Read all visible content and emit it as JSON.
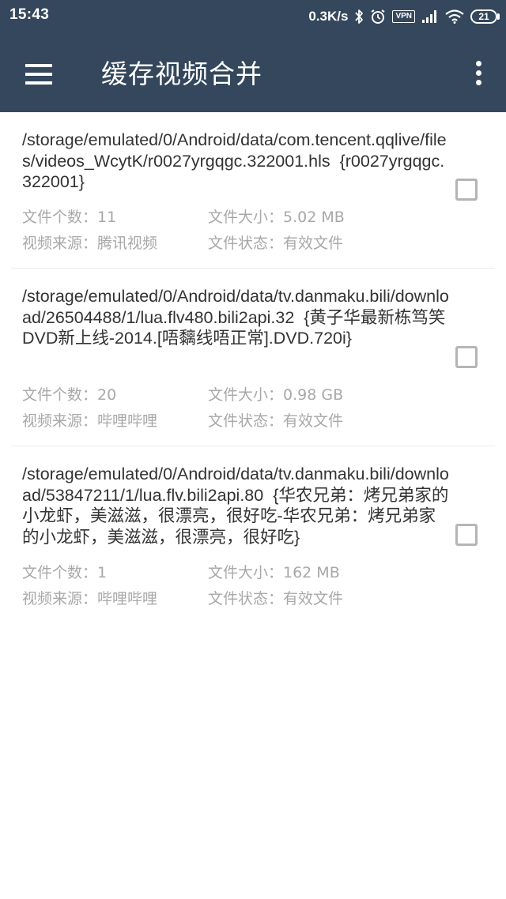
{
  "status_bar": {
    "time": "15:43",
    "network_speed": "0.3K/s",
    "bluetooth_icon": "bluetooth-icon",
    "alarm_icon": "alarm-icon",
    "vpn_label": "VPN",
    "signal_icon": "signal-icon",
    "wifi_icon": "wifi-icon",
    "battery_level": "21"
  },
  "toolbar": {
    "menu_icon": "hamburger-menu-icon",
    "title": "缓存视频合并",
    "overflow_icon": "more-vert-icon",
    "background_color": "#34475c"
  },
  "items": [
    {
      "path": "/storage/emulated/0/Android/data/com.tencent.qqlive/files/videos_WcytK/r0027yrgqgc.322001.hls",
      "name": "{r0027yrgqgc.322001}",
      "file_count_label": "文件个数：11",
      "file_size_label": "文件大小：5.02 MB",
      "source_label": "视频来源：腾讯视频",
      "state_label": "文件状态：有效文件",
      "checked": false
    },
    {
      "path": "/storage/emulated/0/Android/data/tv.danmaku.bili/download/26504488/1/lua.flv480.bili2api.32",
      "name": "{黄子华最新栋笃笑DVD新上线-2014.[唔黐线唔正常].DVD.720i}",
      "file_count_label": "文件个数：20",
      "file_size_label": "文件大小：0.98 GB",
      "source_label": "视频来源：哔哩哔哩",
      "state_label": "文件状态：有效文件",
      "checked": false
    },
    {
      "path": "/storage/emulated/0/Android/data/tv.danmaku.bili/download/53847211/1/lua.flv.bili2api.80",
      "name": "{华农兄弟：烤兄弟家的小龙虾，美滋滋，很漂亮，很好吃-华农兄弟：烤兄弟家的小龙虾，美滋滋，很漂亮，很好吃}",
      "file_count_label": "文件个数：1",
      "file_size_label": "文件大小：162 MB",
      "source_label": "视频来源：哔哩哔哩",
      "state_label": "文件状态：有效文件",
      "checked": false
    }
  ]
}
